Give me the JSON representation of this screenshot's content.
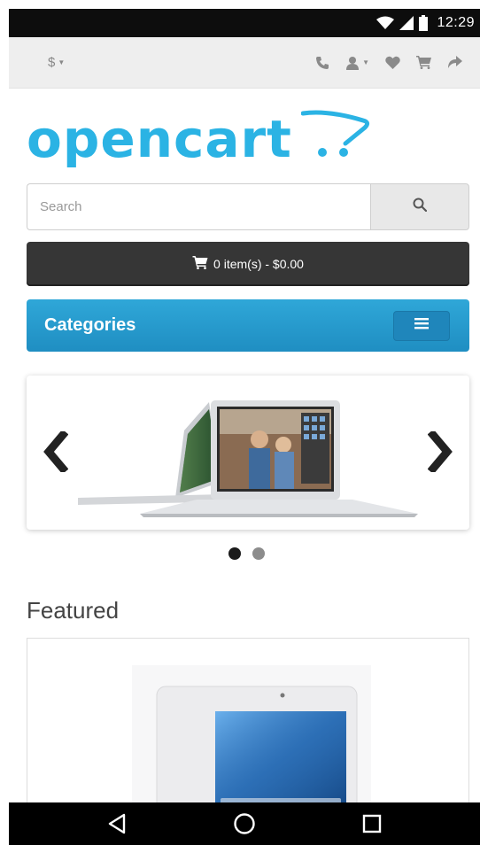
{
  "status_bar": {
    "time": "12:29",
    "icons": [
      "wifi-icon",
      "signal-icon",
      "battery-icon"
    ]
  },
  "top_toolbar": {
    "currency_symbol": "$",
    "icons": [
      "phone-icon",
      "user-icon",
      "heart-icon",
      "cart-icon",
      "share-icon"
    ]
  },
  "logo": {
    "text": "opencart",
    "color": "#2bb3e4"
  },
  "search": {
    "placeholder": "Search",
    "button_icon": "search-icon"
  },
  "cart": {
    "label": "0 item(s) - $0.00",
    "icon": "cart-icon"
  },
  "categories": {
    "title": "Categories",
    "toggle_icon": "hamburger-menu-icon",
    "color": "#2a9fd2"
  },
  "slideshow": {
    "slide_count": 2,
    "active_index": 0,
    "prev_icon": "chevron-left-icon",
    "next_icon": "chevron-right-icon"
  },
  "featured": {
    "title": "Featured"
  },
  "nav_bar": {
    "icons": [
      "back-icon",
      "home-icon",
      "recents-icon"
    ]
  }
}
